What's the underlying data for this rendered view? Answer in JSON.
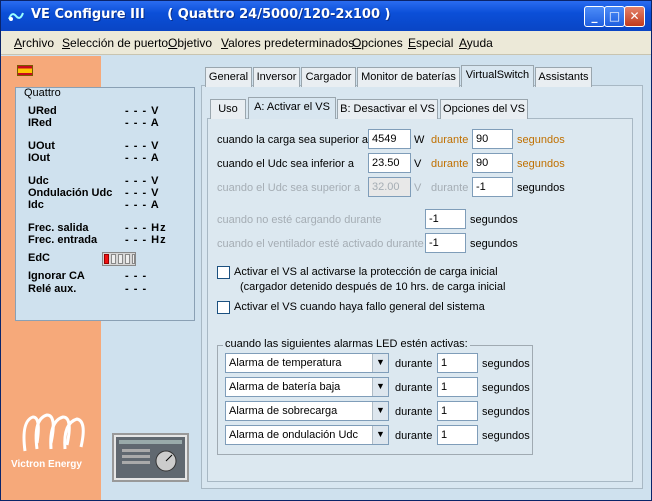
{
  "window": {
    "title": "VE Configure III     ( Quattro 24/5000/120-2x100 )"
  },
  "menu": [
    "Archivo",
    "Selección de puerto",
    "Objetivo",
    "Valores predeterminados",
    "Opciones",
    "Especial",
    "Ayuda"
  ],
  "monitor": {
    "group_label": "Quattro",
    "rows": [
      {
        "label": "URed",
        "value": "- - - V"
      },
      {
        "label": "IRed",
        "value": "- - - A"
      },
      {
        "label": "UOut",
        "value": "- - - V"
      },
      {
        "label": "IOut",
        "value": "- - - A"
      },
      {
        "label": "Udc",
        "value": "- - - V"
      },
      {
        "label": "Ondulación Udc",
        "value": "- - - V"
      },
      {
        "label": "Idc",
        "value": "- - - A"
      },
      {
        "label": "Frec. salida",
        "value": "- - - Hz"
      },
      {
        "label": "Frec. entrada",
        "value": "- - - Hz"
      },
      {
        "label": "EdC",
        "value": ""
      },
      {
        "label": "Ignorar CA",
        "value": "- - -"
      },
      {
        "label": "Relé aux.",
        "value": "- - -"
      }
    ],
    "soc_level": 0.2
  },
  "branding": {
    "logo_text": "Victron Energy"
  },
  "main_tabs": [
    "General",
    "Inversor",
    "Cargador",
    "Monitor de baterías",
    "VirtualSwitch",
    "Assistants"
  ],
  "sub_tabs": [
    "Uso",
    "A: Activar el VS",
    "B: Desactivar el VS",
    "Opciones del VS"
  ],
  "conditions": [
    {
      "label": "cuando la carga sea superior a",
      "value": "4549",
      "unit": "W",
      "during": "durante",
      "time": "90",
      "secs": "segundos"
    },
    {
      "label": "cuando el Udc sea inferior a",
      "value": "23.50",
      "unit": "V",
      "during": "durante",
      "time": "90",
      "secs": "segundos"
    },
    {
      "label": "cuando el Udc sea superior a",
      "value": "32.00",
      "unit": "V",
      "during": "durante",
      "time": "-1",
      "secs": "segundos"
    }
  ],
  "cond_not_charging": {
    "label": "cuando no esté cargando durante",
    "value": "-1",
    "secs": "segundos"
  },
  "cond_fan": {
    "label": "cuando el ventilador esté activado durante",
    "value": "-1",
    "secs": "segundos"
  },
  "chk_overload_line1": "Activar el VS al activarse la protección de carga inicial",
  "chk_overload_line2": "(cargador detenido después de 10 hrs. de carga inicial",
  "chk_failure": "Activar el VS cuando haya fallo general del sistema",
  "alarms": {
    "legend": "cuando las siguientes alarmas LED estén activas:",
    "items": [
      {
        "option": "Alarma de temperatura",
        "during": "durante",
        "value": "1",
        "secs": "segundos"
      },
      {
        "option": "Alarma de batería baja",
        "during": "durante",
        "value": "1",
        "secs": "segundos"
      },
      {
        "option": "Alarma de sobrecarga",
        "during": "durante",
        "value": "1",
        "secs": "segundos"
      },
      {
        "option": "Alarma de ondulación Udc",
        "during": "durante",
        "value": "1",
        "secs": "segundos"
      }
    ]
  }
}
